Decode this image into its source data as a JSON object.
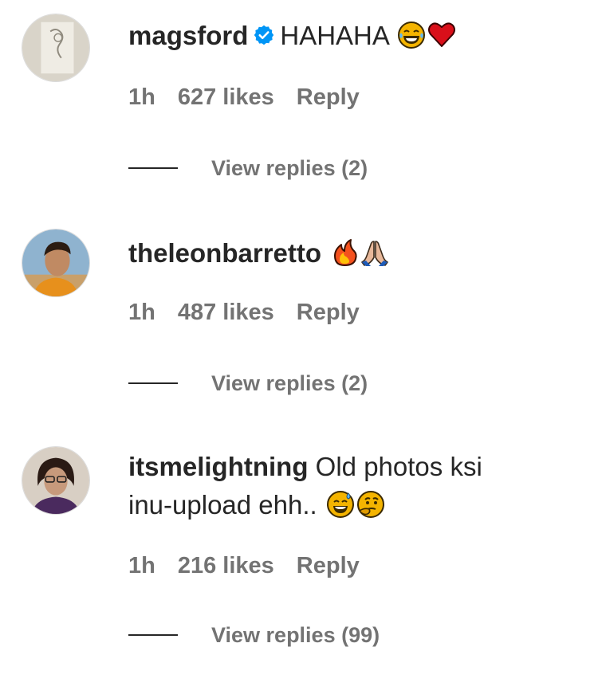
{
  "comments": [
    {
      "username": "magsford",
      "verified": true,
      "text": "HAHAHA",
      "emojis": [
        "laughing-tears-icon",
        "red-heart-icon"
      ],
      "time": "1h",
      "likes": "627 likes",
      "reply_label": "Reply",
      "view_replies": "View replies (2)"
    },
    {
      "username": "theleonbarretto",
      "verified": false,
      "text": "",
      "emojis": [
        "fire-icon",
        "folded-hands-icon"
      ],
      "time": "1h",
      "likes": "487 likes",
      "reply_label": "Reply",
      "view_replies": "View replies (2)"
    },
    {
      "username": "itsmelightning",
      "verified": false,
      "text": "Old photos ksi",
      "text_line2": "inu-upload ehh..",
      "emojis": [
        "sweat-smile-icon",
        "thinking-face-icon"
      ],
      "time": "1h",
      "likes": "216 likes",
      "reply_label": "Reply",
      "view_replies": "View replies (99)"
    }
  ],
  "colors": {
    "text": "#262626",
    "secondary": "#737373",
    "verified": "#0095f6"
  }
}
